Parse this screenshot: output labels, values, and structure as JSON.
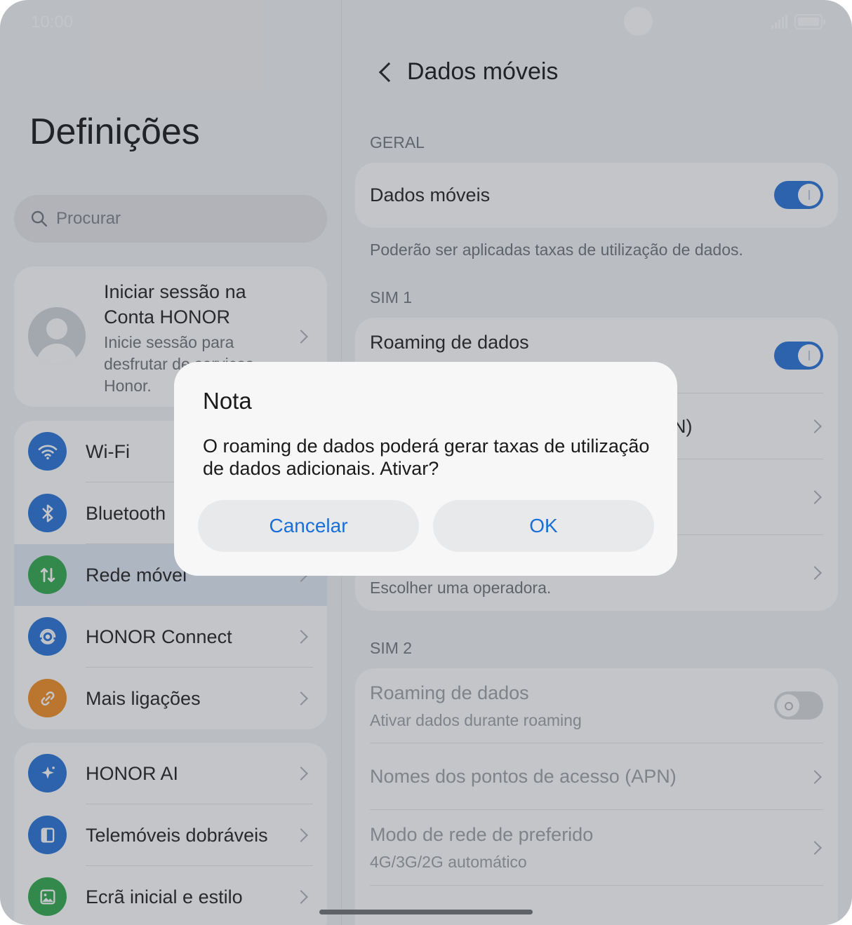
{
  "status_bar": {
    "time": "10:00",
    "signal_icon": "signal-icon",
    "battery_icon": "battery-icon"
  },
  "left": {
    "title": "Definições",
    "search_placeholder": "Procurar",
    "account": {
      "title": "Iniciar sessão na Conta HONOR",
      "subtitle": "Inicie sessão para desfrutar de serviços Honor."
    },
    "group1": [
      {
        "label": "Wi-Fi",
        "icon": "wifi-icon",
        "color": "#1f6fd6"
      },
      {
        "label": "Bluetooth",
        "icon": "bluetooth-icon",
        "color": "#1f6fd6"
      },
      {
        "label": "Rede móvel",
        "icon": "mobile-network-icon",
        "color": "#2aa548",
        "active": true
      },
      {
        "label": "HONOR Connect",
        "icon": "honor-connect-icon",
        "color": "#1f6fd6"
      },
      {
        "label": "Mais ligações",
        "icon": "link-icon",
        "color": "#f08a1c"
      }
    ],
    "group2": [
      {
        "label": "HONOR AI",
        "icon": "sparkle-icon",
        "color": "#1f6fd6"
      },
      {
        "label": "Telemóveis dobráveis",
        "icon": "foldable-icon",
        "color": "#1f6fd6"
      },
      {
        "label": "Ecrã inicial e estilo",
        "icon": "image-icon",
        "color": "#2aa548"
      }
    ]
  },
  "right": {
    "title": "Dados móveis",
    "section_general": "GERAL",
    "mobile_data_label": "Dados móveis",
    "mobile_data_on": true,
    "mobile_data_note": "Poderão ser aplicadas taxas de utilização de dados.",
    "section_sim1": "SIM 1",
    "sim1": {
      "roaming_title": "Roaming de dados",
      "roaming_on": true,
      "apn_partial": "N)",
      "operator_sub": "Escolher uma operadora."
    },
    "section_sim2": "SIM 2",
    "sim2": {
      "roaming_title": "Roaming de dados",
      "roaming_sub": "Ativar dados durante roaming",
      "roaming_on": false,
      "apn_title": "Nomes dos pontos de acesso (APN)",
      "network_mode_title": "Modo de rede de preferido",
      "network_mode_sub": "4G/3G/2G automático"
    }
  },
  "dialog": {
    "title": "Nota",
    "message": "O roaming de dados poderá gerar taxas de utilização de dados adicionais. Ativar?",
    "cancel_label": "Cancelar",
    "ok_label": "OK",
    "button_color": "#1a6fd6"
  }
}
